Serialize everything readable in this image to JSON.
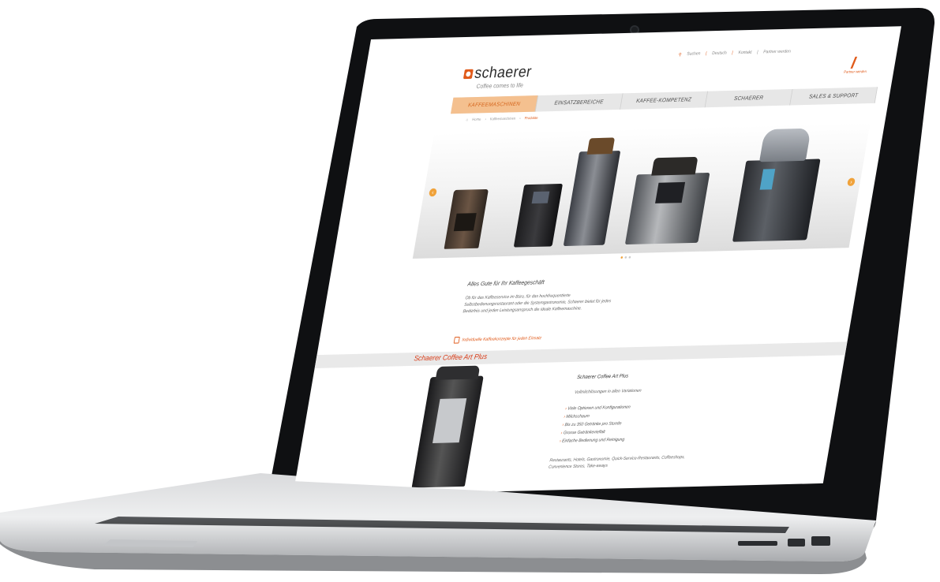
{
  "brand": {
    "logo_text": "schaerer",
    "tagline": "Coffee comes to life"
  },
  "top_bar": {
    "search": "Suchen",
    "language": "Deutsch",
    "links": [
      "Kontakt",
      "Partner werden"
    ]
  },
  "partner": {
    "label": "Partner werden"
  },
  "nav": {
    "tabs": [
      "KAFFEEMASCHINEN",
      "EINSATZBEREICHE",
      "KAFFEE-KOMPETENZ",
      "SCHAERER",
      "SALES & SUPPORT"
    ],
    "active_index": 0
  },
  "breadcrumb": [
    "Home",
    "Kaffeemaschinen",
    "Produkte"
  ],
  "hero": {
    "slide_count": 3,
    "active_slide": 0
  },
  "intro": {
    "title": "Alles Gute für Ihr Kaffeegeschäft",
    "body": "Ob für das Kaffeeservice im Büro, für das hochfrequentierte Selbstbedienungsrestaurant oder die Systemgastronomie, Schaerer bietet für jedes Bedürfnis und jeden Leistungsanspruch die ideale Kaffeemaschine.",
    "link": "Individuelle Kaffeekonzepte für jeden Einsatz"
  },
  "product": {
    "band_title": "Schaerer Coffee Art Plus",
    "name": "Schaerer Coffee Art Plus",
    "subtitle": "Vollmilchlösungen in allen Variationen",
    "features": [
      "Viele Optionen und Konfigurationen",
      "Milchschaum",
      "Bis zu 350 Getränke pro Stunde",
      "Grosse Getränkevielfalt",
      "Einfache Bedienung und Reinigung"
    ],
    "footer": "Restaurants, Hotels, Gastronomie, Quick-Service-Restaurants, Coffeeshops, Convenience Stores, Take-aways"
  },
  "colors": {
    "accent": "#e05a1a",
    "accent_light": "#f0a23a",
    "band": "#e9e9e9",
    "product_title": "#d83a15"
  }
}
